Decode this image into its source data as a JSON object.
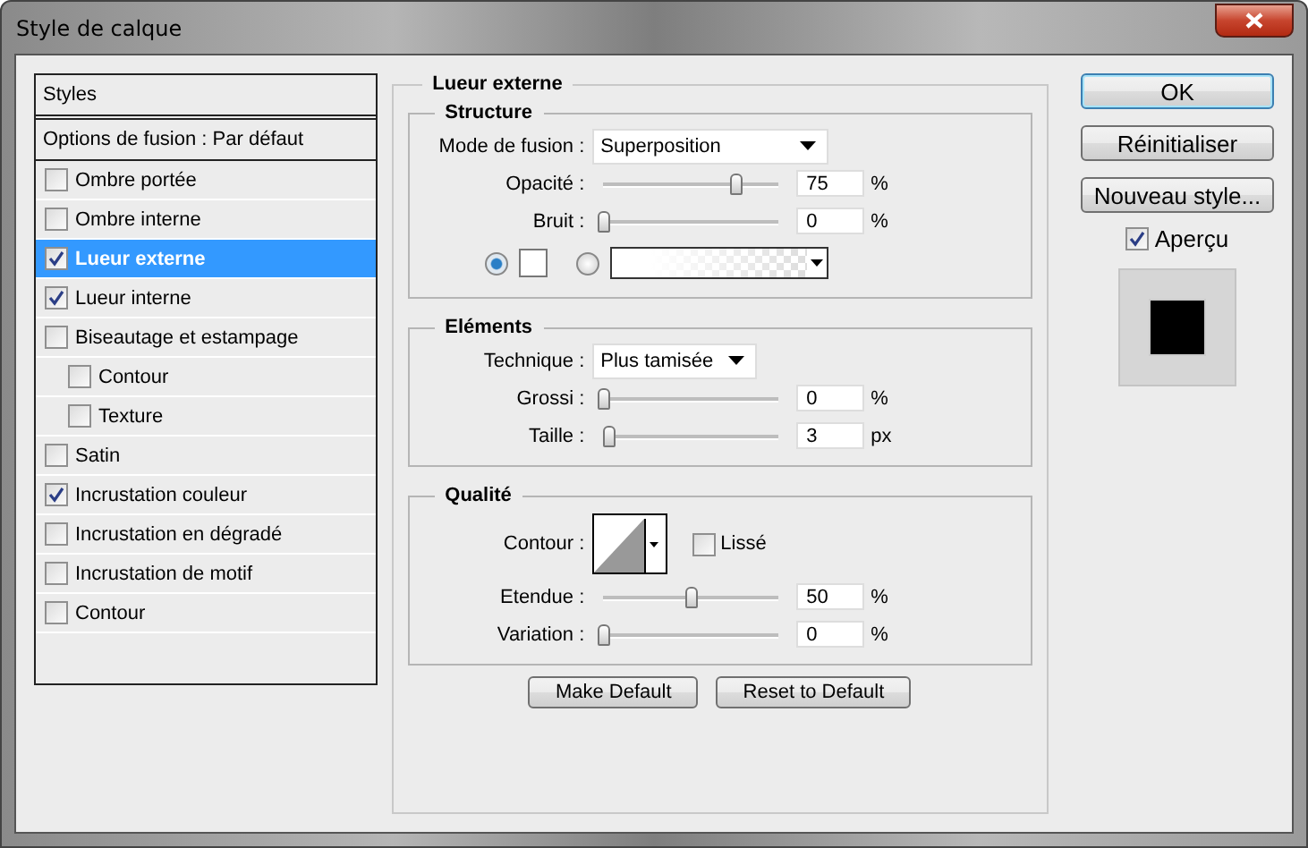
{
  "window": {
    "title": "Style de calque"
  },
  "styles_list": {
    "header": "Styles",
    "blending": "Options de fusion : Par défaut",
    "items": [
      {
        "label": "Ombre portée",
        "checked": false,
        "selected": false
      },
      {
        "label": "Ombre interne",
        "checked": false,
        "selected": false
      },
      {
        "label": "Lueur externe",
        "checked": true,
        "selected": true
      },
      {
        "label": "Lueur interne",
        "checked": true,
        "selected": false
      },
      {
        "label": "Biseautage et estampage",
        "checked": false,
        "selected": false,
        "children": [
          {
            "label": "Contour",
            "checked": false,
            "selected": false
          },
          {
            "label": "Texture",
            "checked": false,
            "selected": false
          }
        ]
      },
      {
        "label": "Satin",
        "checked": false,
        "selected": false
      },
      {
        "label": "Incrustation couleur",
        "checked": true,
        "selected": false
      },
      {
        "label": "Incrustation en dégradé",
        "checked": false,
        "selected": false
      },
      {
        "label": "Incrustation de motif",
        "checked": false,
        "selected": false
      },
      {
        "label": "Contour",
        "checked": false,
        "selected": false
      }
    ]
  },
  "panel": {
    "title": "Lueur externe",
    "structure": {
      "title": "Structure",
      "blend_mode": {
        "label": "Mode de fusion :",
        "value": "Superposition"
      },
      "sliders": [
        {
          "label": "Opacité :",
          "level": 0.76,
          "value": "75",
          "unit": "%"
        },
        {
          "label": "Bruit :",
          "level": 0,
          "value": "0",
          "unit": "%"
        }
      ],
      "fill_options": [
        {
          "kind": "color",
          "selected": true
        },
        {
          "kind": "gradient",
          "selected": false
        }
      ]
    },
    "elements": {
      "title": "Eléments",
      "technique": {
        "label": "Technique :",
        "value": "Plus tamisée"
      },
      "sliders": [
        {
          "label": "Grossi :",
          "level": 0,
          "value": "0",
          "unit": "%"
        },
        {
          "label": "Taille :",
          "level": 0.03,
          "value": "3",
          "unit": "px"
        }
      ]
    },
    "quality": {
      "title": "Qualité",
      "contour": {
        "label": "Contour :"
      },
      "smooth": {
        "label": "Lissé",
        "checked": false
      },
      "sliders": [
        {
          "label": "Etendue :",
          "level": 0.5,
          "value": "50",
          "unit": "%"
        },
        {
          "label": "Variation :",
          "level": 0,
          "value": "0",
          "unit": "%"
        }
      ]
    },
    "buttons": [
      "Make Default",
      "Reset to Default"
    ]
  },
  "actions": [
    {
      "label": "OK",
      "focused": true
    },
    {
      "label": "Réinitialiser",
      "focused": false
    },
    {
      "label": "Nouveau style...",
      "focused": false
    }
  ],
  "preview": {
    "label": "Aperçu",
    "checked": true
  }
}
